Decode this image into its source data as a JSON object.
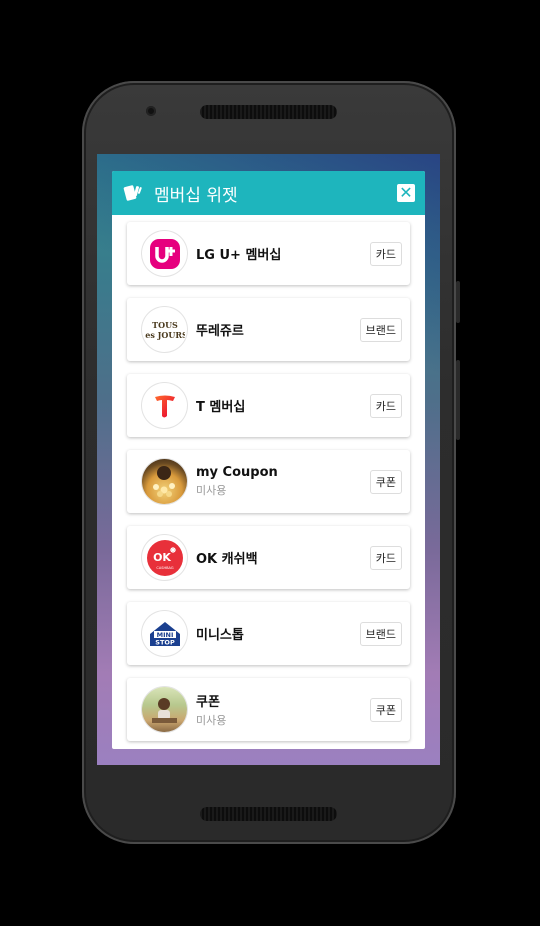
{
  "dialog": {
    "title": "멤버십 위젯",
    "close_icon": "close-icon",
    "header_color": "#1eb5bd"
  },
  "items": [
    {
      "name": "LG U+ 멤버십",
      "sub": "",
      "tag": "카드",
      "icon": "lg-uplus-logo"
    },
    {
      "name": "뚜레쥬르",
      "sub": "",
      "tag": "브랜드",
      "icon": "tous-les-jours-logo"
    },
    {
      "name": "T 멤버십",
      "sub": "",
      "tag": "카드",
      "icon": "t-membership-logo"
    },
    {
      "name": "my Coupon",
      "sub": "미사용",
      "tag": "쿠폰",
      "icon": "popcorn-photo"
    },
    {
      "name": "OK 캐쉬백",
      "sub": "",
      "tag": "카드",
      "icon": "ok-cashbag-logo"
    },
    {
      "name": "미니스톱",
      "sub": "",
      "tag": "브랜드",
      "icon": "ministop-logo"
    },
    {
      "name": "쿠폰",
      "sub": "미사용",
      "tag": "쿠폰",
      "icon": "child-photo"
    }
  ]
}
